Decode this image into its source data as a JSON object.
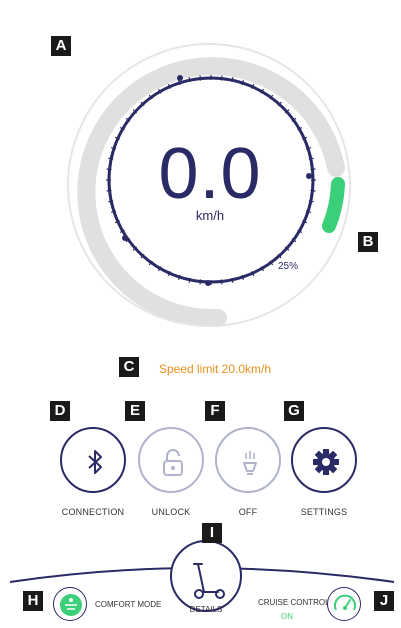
{
  "gauge": {
    "speed_value": "0.0",
    "speed_unit": "km/h",
    "battery_percent": "25%",
    "battery_level": 0.25,
    "colors": {
      "ring": "#2a2a66",
      "track": "#e0e0e0",
      "battery": "#3ccf7a"
    }
  },
  "speed_limit": "Speed limit 20.0km/h",
  "controls": [
    {
      "label": "CONNECTION",
      "icon": "bluetooth-icon",
      "faded": false
    },
    {
      "label": "UNLOCK",
      "icon": "lock-icon",
      "faded": true
    },
    {
      "label": "OFF",
      "icon": "light-icon",
      "faded": true
    },
    {
      "label": "SETTINGS",
      "icon": "gear-icon",
      "faded": false
    }
  ],
  "bottom": {
    "comfort_mode_label": "COMFORT MODE",
    "details_label": "DETAILS",
    "cruise_control_label": "CRUISE CONTROL",
    "cruise_control_status": "ON",
    "colors": {
      "mode_icon": "#3ccf7a",
      "status_on": "#3ccf7a"
    }
  },
  "markers": [
    "A",
    "B",
    "C",
    "D",
    "E",
    "F",
    "G",
    "H",
    "I",
    "J"
  ]
}
